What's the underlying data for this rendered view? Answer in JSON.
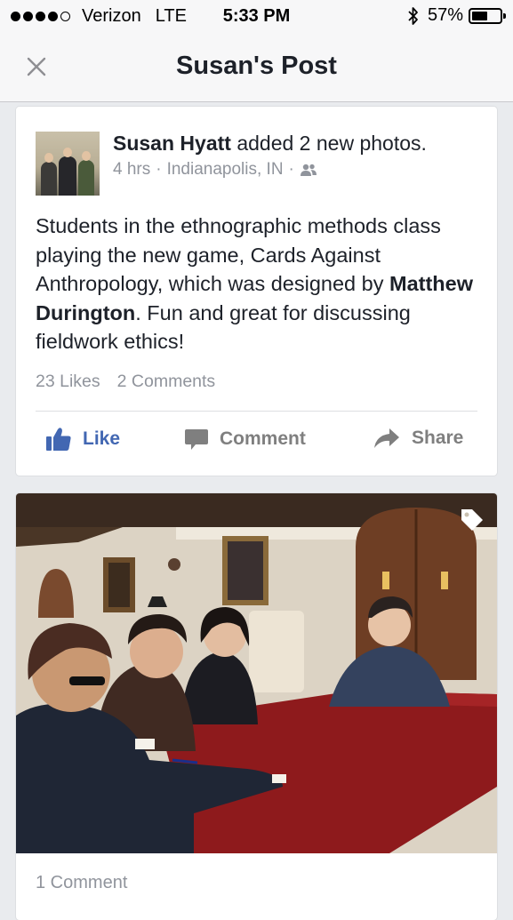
{
  "status_bar": {
    "carrier": "Verizon",
    "network": "LTE",
    "time": "5:33 PM",
    "battery_percent": "57%",
    "battery_level": 0.57,
    "signal_bars_filled": 4,
    "signal_bars_total": 5
  },
  "nav": {
    "title": "Susan's Post",
    "close_icon": "close-icon"
  },
  "post": {
    "author": "Susan Hyatt",
    "action_text": " added 2 new photos.",
    "time": "4 hrs",
    "location": "Indianapolis, IN",
    "audience_icon": "friends-icon",
    "text_before": "Students in the ethnographic methods class playing the new game, Cards Against Anthropology, which was designed by ",
    "text_bold": "Matthew Durington",
    "text_after": ".  Fun and great for discussing fieldwork ethics!",
    "likes": "23 Likes",
    "comments": "2 Comments",
    "actions": {
      "like": "Like",
      "comment": "Comment",
      "share": "Share"
    }
  },
  "photo": {
    "tag_icon": "tag-icon",
    "comments": "1 Comment"
  },
  "colors": {
    "accent": "#4267b2",
    "secondary_text": "#90949c",
    "background": "#e9ebee"
  }
}
